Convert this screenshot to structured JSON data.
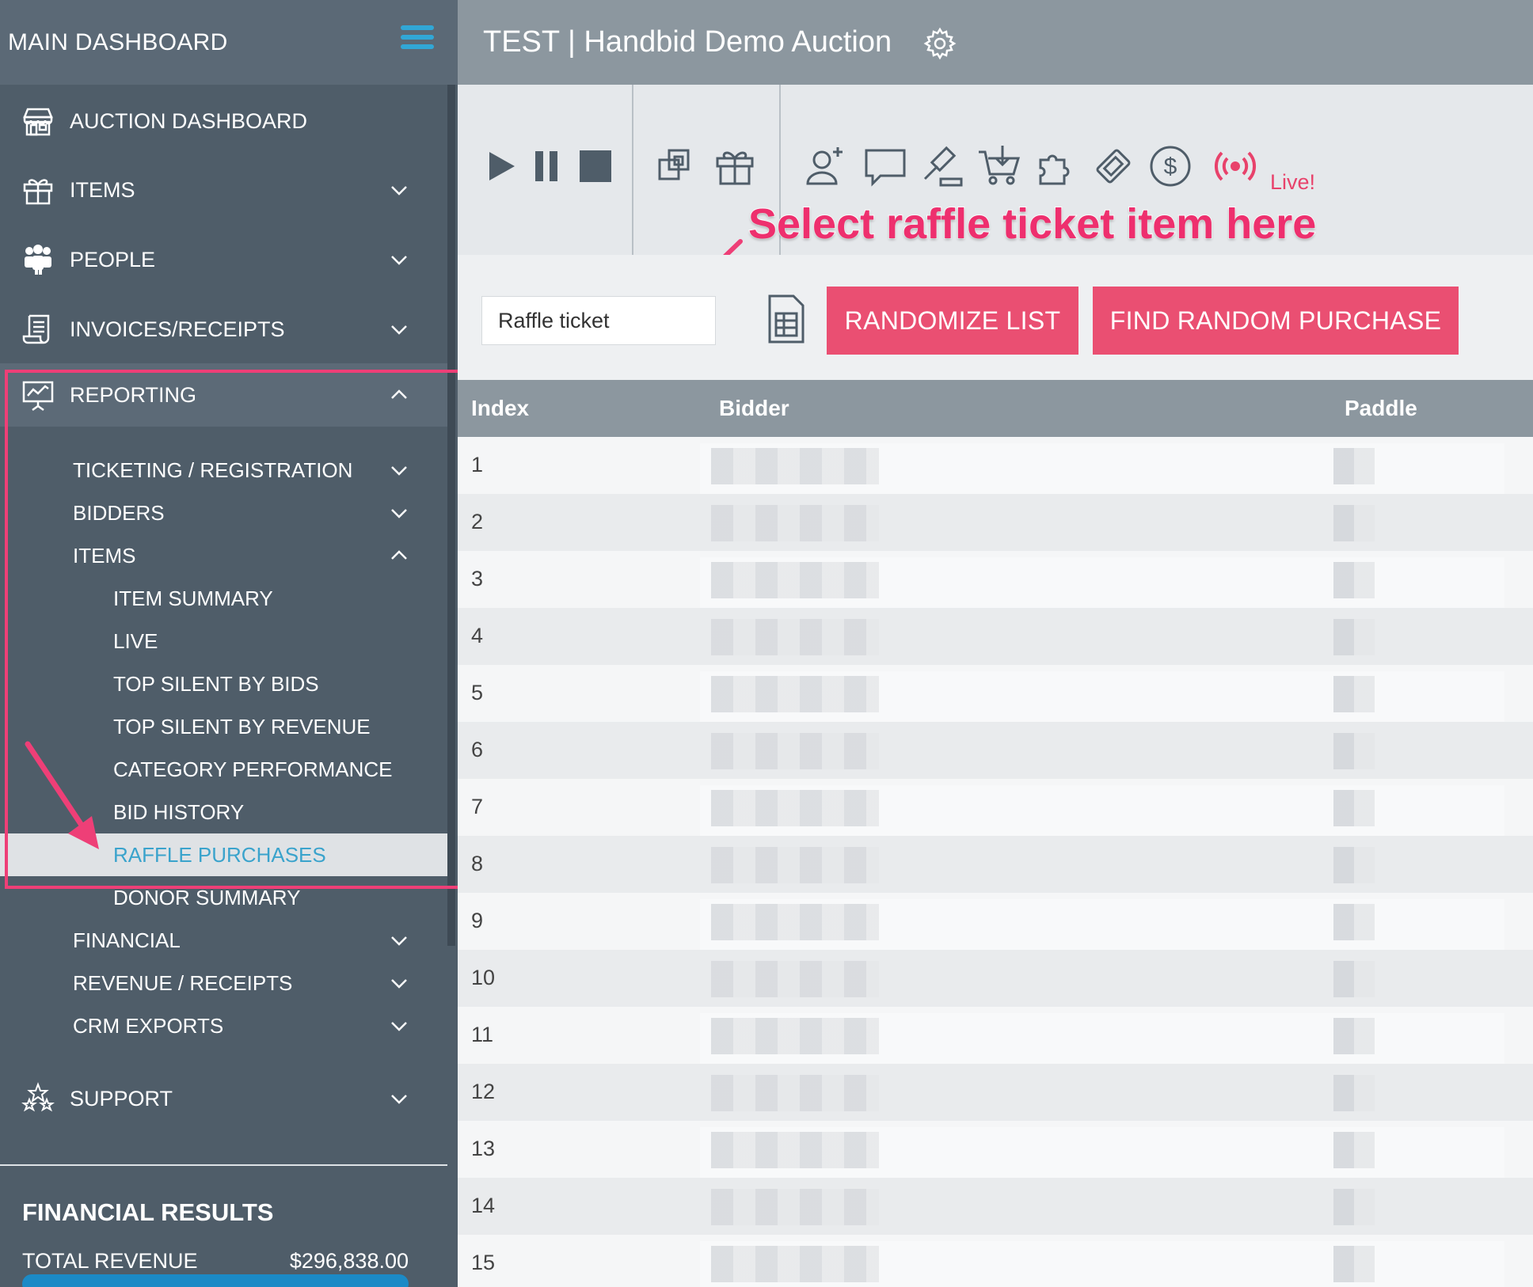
{
  "sidebar": {
    "header": "MAIN DASHBOARD",
    "items": [
      {
        "label": "AUCTION DASHBOARD"
      },
      {
        "label": "ITEMS"
      },
      {
        "label": "PEOPLE"
      },
      {
        "label": "INVOICES/RECEIPTS"
      },
      {
        "label": "REPORTING"
      }
    ],
    "reporting_sub": [
      {
        "label": "TICKETING / REGISTRATION"
      },
      {
        "label": "BIDDERS"
      },
      {
        "label": "ITEMS"
      },
      {
        "label": "ITEM SUMMARY"
      },
      {
        "label": "LIVE"
      },
      {
        "label": "TOP SILENT BY BIDS"
      },
      {
        "label": "TOP SILENT BY REVENUE"
      },
      {
        "label": "CATEGORY PERFORMANCE"
      },
      {
        "label": "BID HISTORY"
      },
      {
        "label": "RAFFLE PURCHASES"
      },
      {
        "label": "DONOR SUMMARY"
      },
      {
        "label": "FINANCIAL"
      },
      {
        "label": "REVENUE / RECEIPTS"
      },
      {
        "label": "CRM EXPORTS"
      }
    ],
    "support": "SUPPORT",
    "financial_results": {
      "title": "FINANCIAL RESULTS",
      "total_revenue_label": "TOTAL REVENUE",
      "total_revenue_value": "$296,838.00"
    }
  },
  "header": {
    "title": "TEST | Handbid Demo Auction"
  },
  "toolbar": {
    "live_label": "Live!"
  },
  "annotation": {
    "text": "Select raffle ticket item here"
  },
  "controls": {
    "item_select_value": "Raffle ticket",
    "randomize_label": "RANDOMIZE LIST",
    "find_label": "FIND RANDOM PURCHASE"
  },
  "table": {
    "columns": [
      "Index",
      "Bidder",
      "Paddle"
    ],
    "rows": [
      "1",
      "2",
      "3",
      "4",
      "5",
      "6",
      "7",
      "8",
      "9",
      "10",
      "11",
      "12",
      "13",
      "14",
      "15"
    ]
  },
  "colors": {
    "sidebar_bg": "#4f5d69",
    "accent_pink": "#ea4f72",
    "active_link": "#3aa3cc",
    "topbar_bg": "#8c979f"
  }
}
